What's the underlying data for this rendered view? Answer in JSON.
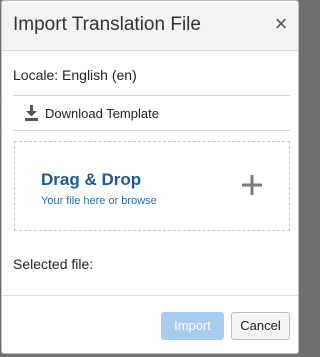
{
  "dialog": {
    "title": "Import Translation File",
    "close_glyph": "×",
    "locale_text": "Locale: English (en)",
    "download": {
      "label": "Download Template",
      "icon": "download-icon"
    },
    "dropzone": {
      "title": "Drag & Drop",
      "subtitle": "Your file here or browse",
      "icon": "plus-icon"
    },
    "selected_file_label": "Selected file:",
    "buttons": {
      "import_label": "Import",
      "cancel_label": "Cancel"
    }
  },
  "colors": {
    "accent_dark": "#1e5a8c",
    "accent_link": "#2a6fa8",
    "import_disabled_bg": "#a7cbea"
  }
}
